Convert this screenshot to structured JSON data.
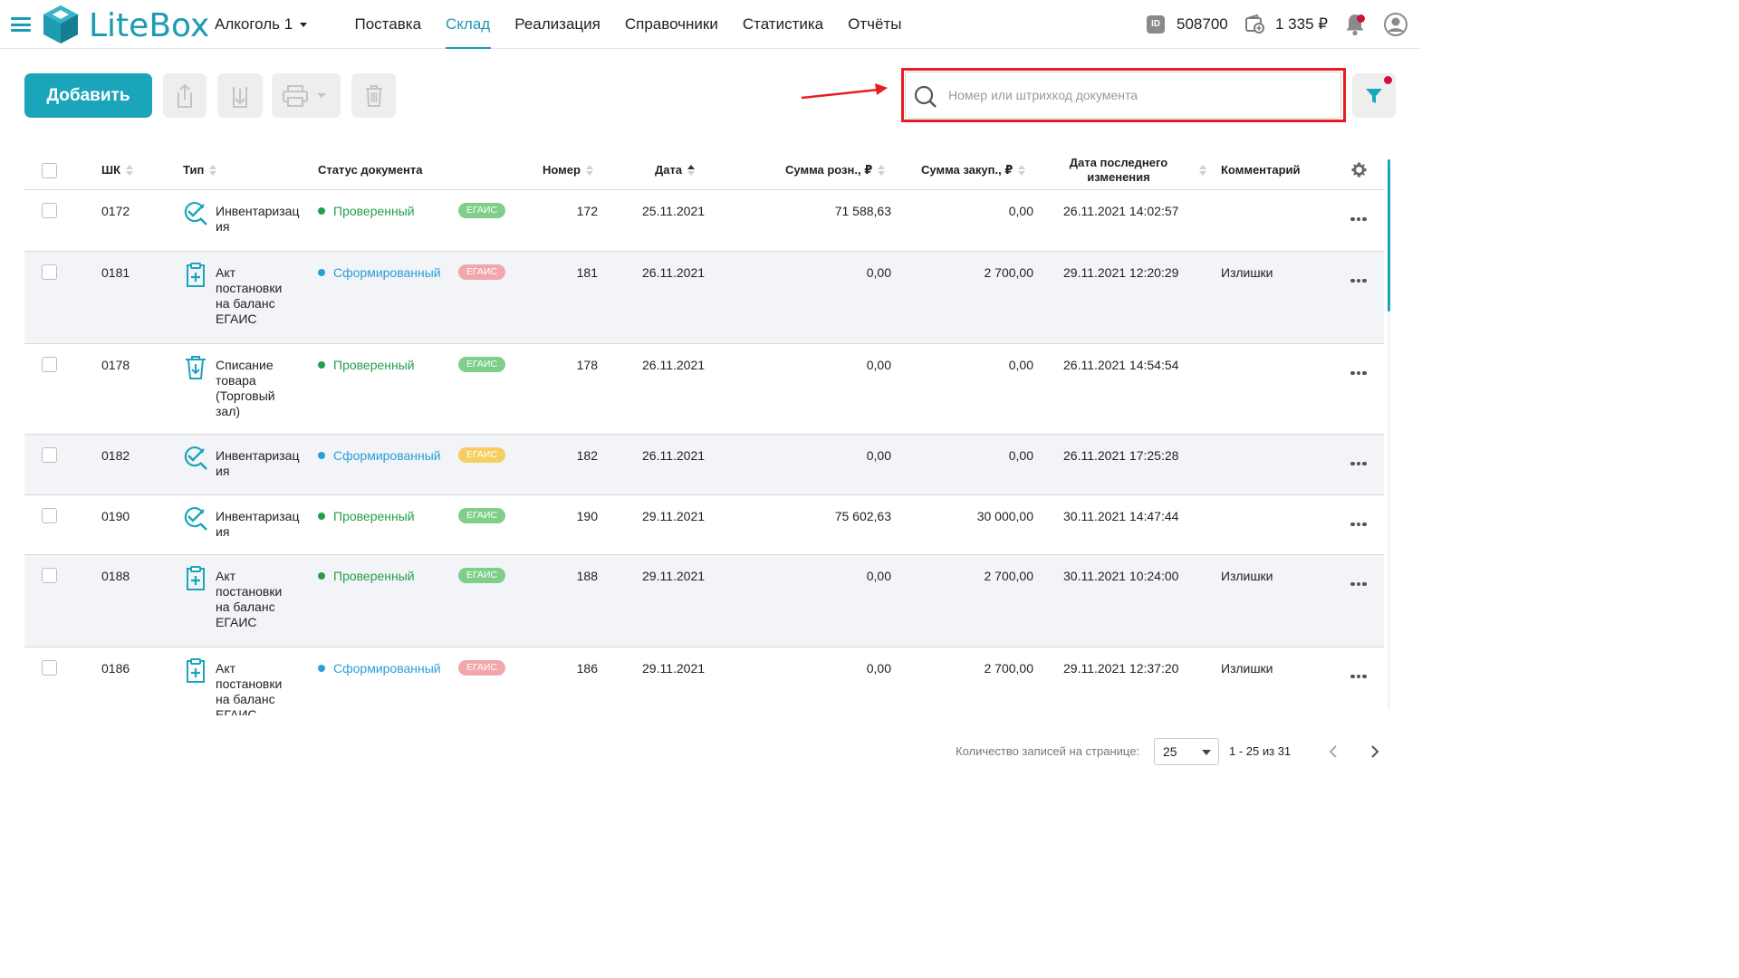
{
  "header": {
    "logo_text": "LiteBox",
    "store": "Алкоголь 1",
    "nav": [
      "Поставка",
      "Склад",
      "Реализация",
      "Справочники",
      "Статистика",
      "Отчёты"
    ],
    "active_nav": "Склад",
    "id_badge": "ID",
    "account_id": "508700",
    "balance": "1 335 ₽"
  },
  "toolbar": {
    "add_label": "Добавить",
    "search_placeholder": "Номер или штрихкод документа",
    "search_value": ""
  },
  "table": {
    "columns": {
      "sh": "ШК",
      "type": "Тип",
      "status": "Статус документа",
      "number": "Номер",
      "date": "Дата",
      "retail": "Сумма розн., ₽",
      "purchase": "Сумма закуп., ₽",
      "modified_line1": "Дата последнего",
      "modified_line2": "изменения",
      "comment": "Комментарий"
    },
    "rows": [
      {
        "sh": "0172",
        "type": "Инвентаризация",
        "type_icon": "inventory-check-icon",
        "status": "Проверенный",
        "status_color": "green",
        "badge": "ЕГАИС",
        "badge_color": "green",
        "number": "172",
        "date": "25.11.2021",
        "retail": "71 588,63",
        "purchase": "0,00",
        "modified": "26.11.2021 14:02:57",
        "comment": ""
      },
      {
        "sh": "0181",
        "type": "Акт постановки на баланс ЕГАИС",
        "type_icon": "clipboard-plus-icon",
        "status": "Сформированный",
        "status_color": "blue",
        "badge": "ЕГАИС",
        "badge_color": "red",
        "number": "181",
        "date": "26.11.2021",
        "retail": "0,00",
        "purchase": "2 700,00",
        "modified": "29.11.2021 12:20:29",
        "comment": "Излишки"
      },
      {
        "sh": "0178",
        "type": "Списание товара (Торговый зал)",
        "type_icon": "trash-writeoff-icon",
        "status": "Проверенный",
        "status_color": "green",
        "badge": "ЕГАИС",
        "badge_color": "green",
        "number": "178",
        "date": "26.11.2021",
        "retail": "0,00",
        "purchase": "0,00",
        "modified": "26.11.2021 14:54:54",
        "comment": ""
      },
      {
        "sh": "0182",
        "type": "Инвентаризация",
        "type_icon": "inventory-check-icon",
        "status": "Сформированный",
        "status_color": "blue",
        "badge": "ЕГАИС",
        "badge_color": "yellow",
        "number": "182",
        "date": "26.11.2021",
        "retail": "0,00",
        "purchase": "0,00",
        "modified": "26.11.2021 17:25:28",
        "comment": ""
      },
      {
        "sh": "0190",
        "type": "Инвентаризация",
        "type_icon": "inventory-check-icon",
        "status": "Проверенный",
        "status_color": "green",
        "badge": "ЕГАИС",
        "badge_color": "green",
        "number": "190",
        "date": "29.11.2021",
        "retail": "75 602,63",
        "purchase": "30 000,00",
        "modified": "30.11.2021 14:47:44",
        "comment": ""
      },
      {
        "sh": "0188",
        "type": "Акт постановки на баланс ЕГАИС",
        "type_icon": "clipboard-plus-icon",
        "status": "Проверенный",
        "status_color": "green",
        "badge": "ЕГАИС",
        "badge_color": "green",
        "number": "188",
        "date": "29.11.2021",
        "retail": "0,00",
        "purchase": "2 700,00",
        "modified": "30.11.2021 10:24:00",
        "comment": "Излишки"
      },
      {
        "sh": "0186",
        "type": "Акт постановки на баланс ЕГАИС",
        "type_icon": "clipboard-plus-icon",
        "status": "Сформированный",
        "status_color": "blue",
        "badge": "ЕГАИС",
        "badge_color": "red",
        "number": "186",
        "date": "29.11.2021",
        "retail": "0,00",
        "purchase": "2 700,00",
        "modified": "29.11.2021 12:37:20",
        "comment": "Излишки"
      }
    ]
  },
  "pagination": {
    "per_page_label": "Количество записей на странице:",
    "per_page": "25",
    "range": "1 - 25 из 31"
  },
  "colors": {
    "accent": "#1ba5ba",
    "status_green": "#23a04a",
    "status_blue": "#2a9fd8",
    "annotation_red": "#e51d24",
    "notification_dot": "#d0113d"
  }
}
